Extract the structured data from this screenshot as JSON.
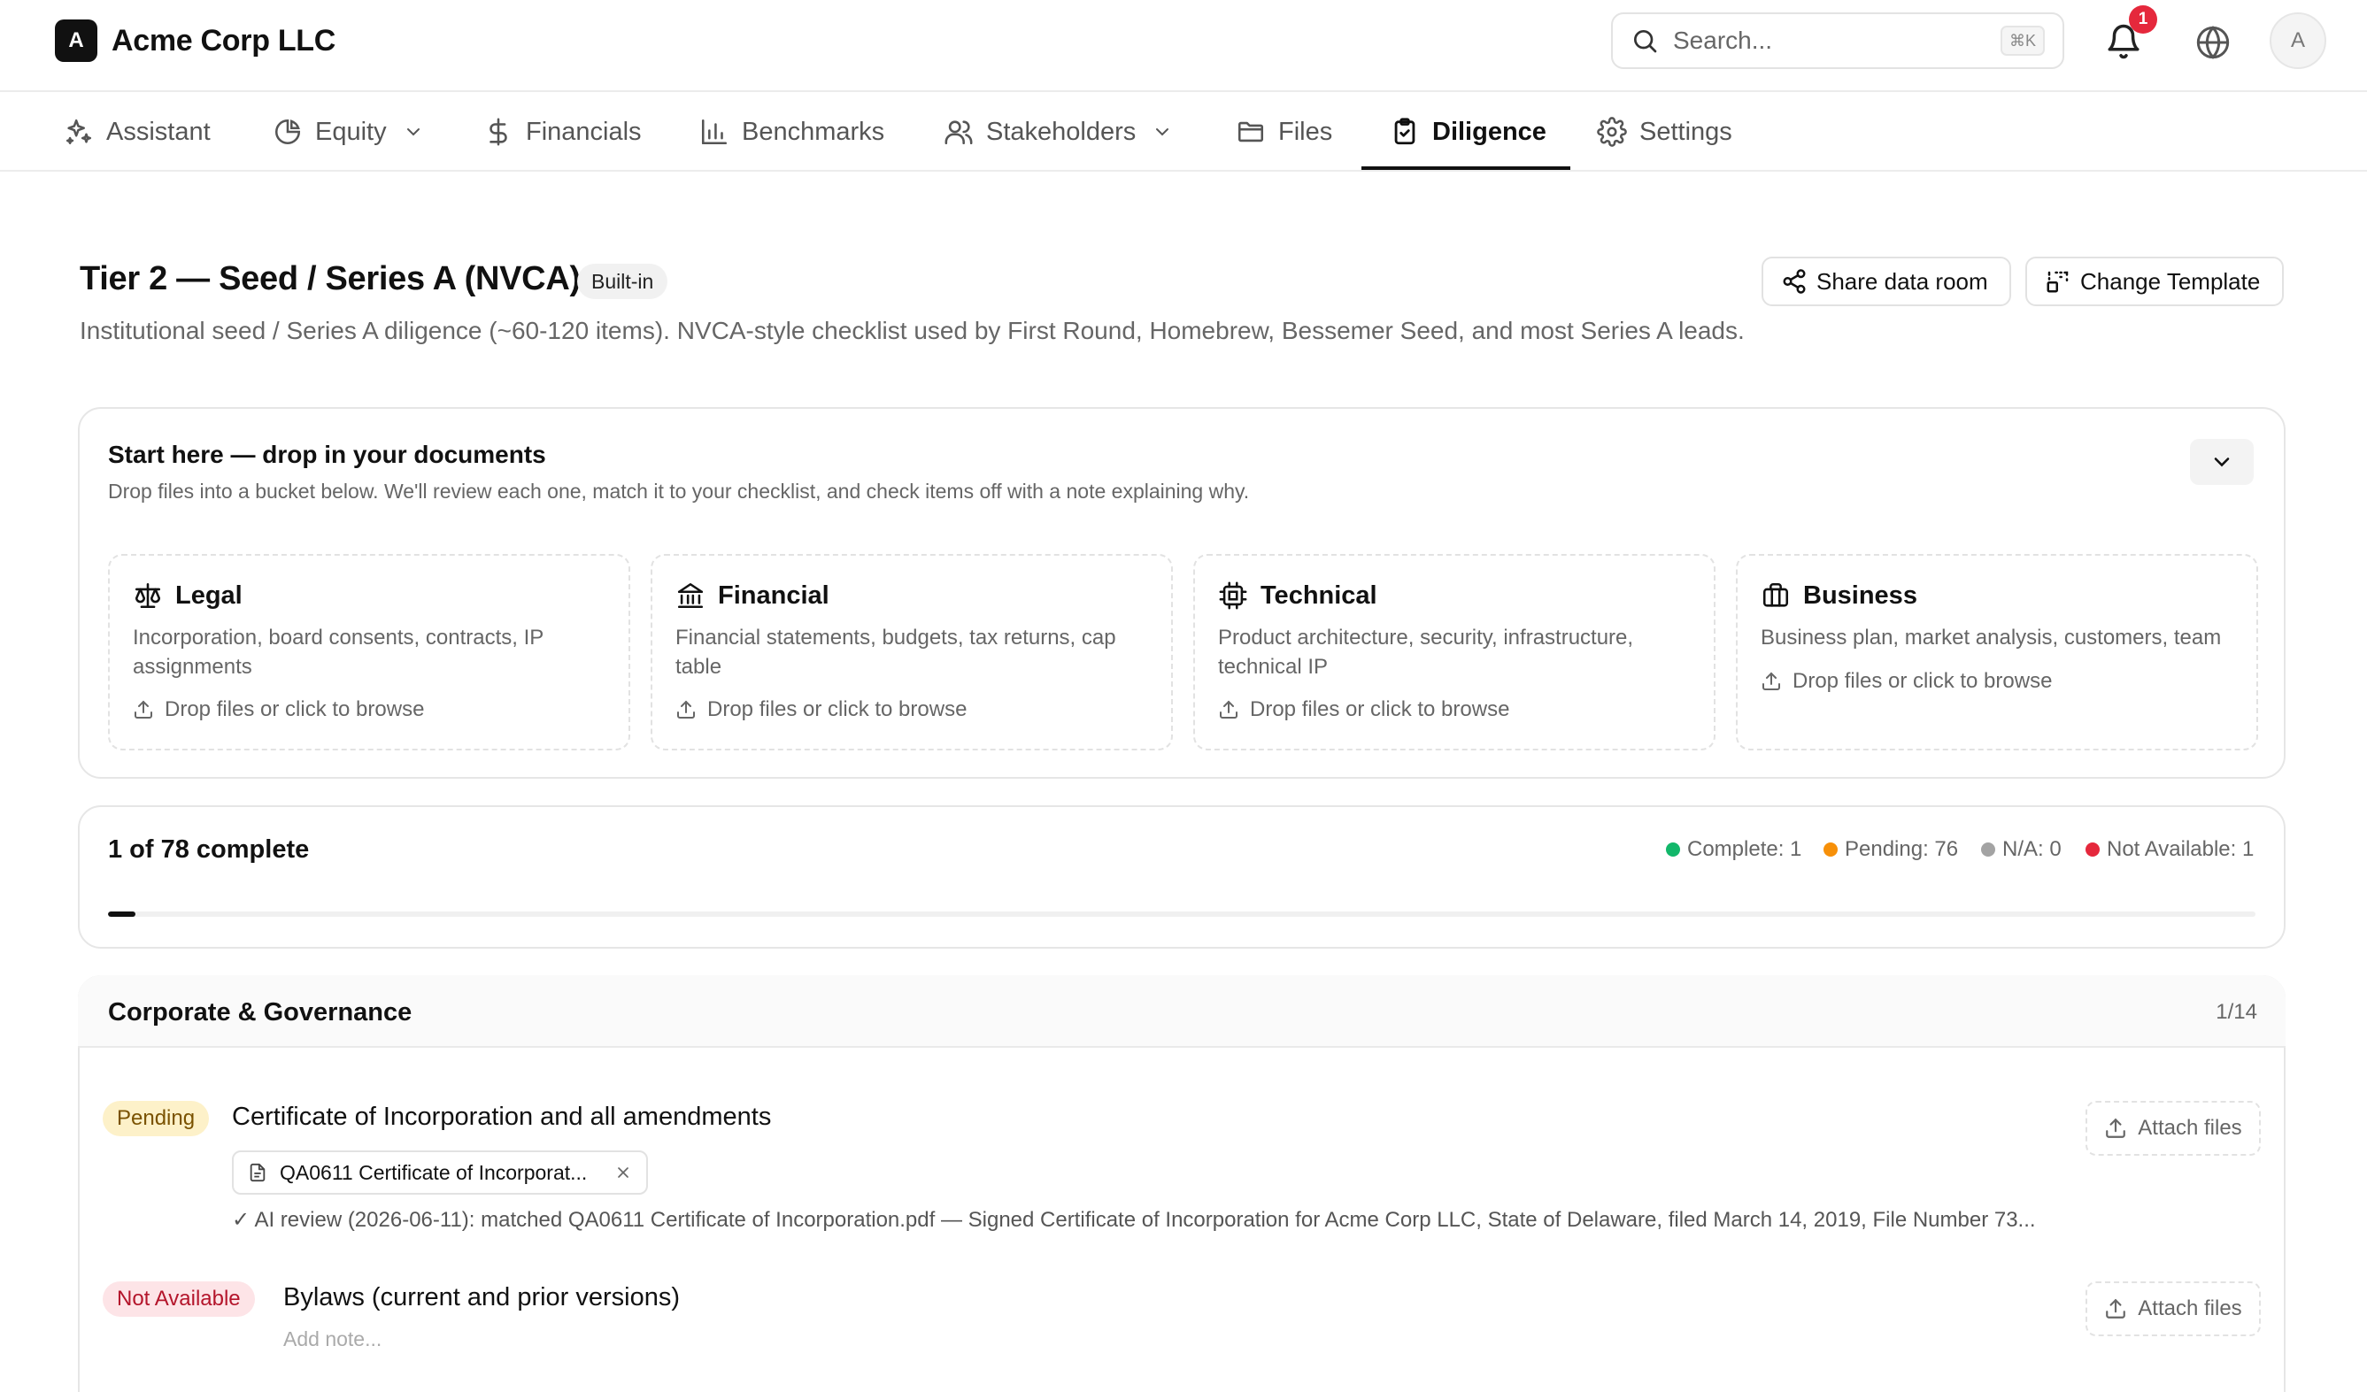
{
  "app": {
    "logo_letter": "A",
    "company_name": "Acme Corp LLC"
  },
  "topbar": {
    "search_placeholder": "Search...",
    "search_shortcut": "⌘K",
    "notification_count": "1",
    "avatar_letter": "A"
  },
  "nav": {
    "items": [
      {
        "label": "Assistant",
        "icon": "sparkles-icon"
      },
      {
        "label": "Equity",
        "icon": "pie-chart-icon",
        "dropdown": true
      },
      {
        "label": "Financials",
        "icon": "dollar-icon"
      },
      {
        "label": "Benchmarks",
        "icon": "bar-chart-icon"
      },
      {
        "label": "Stakeholders",
        "icon": "users-icon",
        "dropdown": true
      },
      {
        "label": "Files",
        "icon": "folder-icon"
      },
      {
        "label": "Diligence",
        "icon": "clipboard-check-icon",
        "active": true
      },
      {
        "label": "Settings",
        "icon": "gear-icon"
      }
    ]
  },
  "header": {
    "title": "Tier 2 — Seed / Series A (NVCA)",
    "badge": "Built-in",
    "description": "Institutional seed / Series A diligence (~60-120 items). NVCA-style checklist used by First Round, Homebrew, Bessemer Seed, and most Series A leads.",
    "share_label": "Share data room",
    "change_template_label": "Change Template"
  },
  "upload": {
    "title": "Start here — drop in your documents",
    "subtitle": "Drop files into a bucket below. We'll review each one, match it to your checklist, and check items off with a note explaining why.",
    "buckets": [
      {
        "title": "Legal",
        "icon": "scale-icon",
        "description": "Incorporation, board consents, contracts, IP assignments",
        "drop_label": "Drop files or click to browse"
      },
      {
        "title": "Financial",
        "icon": "bank-icon",
        "description": "Financial statements, budgets, tax returns, cap table",
        "drop_label": "Drop files or click to browse"
      },
      {
        "title": "Technical",
        "icon": "cpu-icon",
        "description": "Product architecture, security, infrastructure, technical IP",
        "drop_label": "Drop files or click to browse"
      },
      {
        "title": "Business",
        "icon": "briefcase-icon",
        "description": "Business plan, market analysis, customers, team",
        "drop_label": "Drop files or click to browse"
      }
    ]
  },
  "progress": {
    "label": "1 of 78 complete",
    "fraction": 0.0128,
    "legend": [
      {
        "label": "Complete: 1",
        "color": "#12b76a"
      },
      {
        "label": "Pending: 76",
        "color": "#f79009"
      },
      {
        "label": "N/A: 0",
        "color": "#a3a3a3"
      },
      {
        "label": "Not Available: 1",
        "color": "#e5283c"
      }
    ]
  },
  "section": {
    "title": "Corporate & Governance",
    "count": "1/14",
    "items": [
      {
        "status": "Pending",
        "title": "Certificate of Incorporation and all amendments",
        "file_name": "QA0611 Certificate of Incorporat...",
        "ai_note": "✓ AI review (2026-06-11): matched QA0611 Certificate of Incorporation.pdf — Signed Certificate of Incorporation for Acme Corp LLC, State of Delaware, filed March 14, 2019, File Number 73...",
        "attach_label": "Attach files"
      },
      {
        "status": "Not Available",
        "title": "Bylaws (current and prior versions)",
        "note_placeholder": "Add note...",
        "attach_label": "Attach files"
      }
    ]
  }
}
